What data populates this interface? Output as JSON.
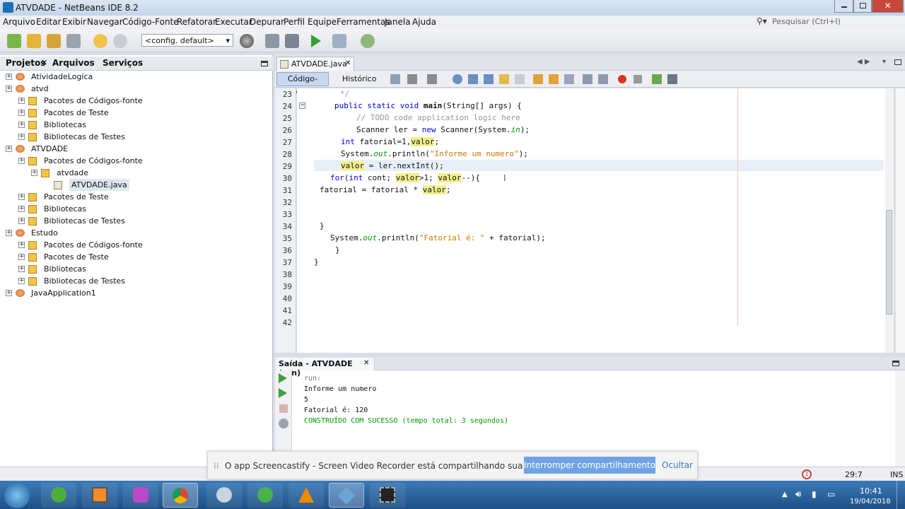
{
  "window": {
    "title": "ATVDADE - NetBeans IDE 8.2"
  },
  "menu": [
    "Arquivo",
    "Editar",
    "Exibir",
    "Navegar",
    "Código-Fonte",
    "Refatorar",
    "Executar",
    "Depurar",
    "Perfil",
    "Equipe",
    "Ferramentas",
    "Janela",
    "Ajuda"
  ],
  "search": {
    "placeholder": "Pesquisar (Ctrl+I)"
  },
  "toolbar": {
    "config": "<config. default>"
  },
  "left_tabs": [
    "Projetos",
    "Arquivos",
    "Serviços"
  ],
  "tree": [
    {
      "label": "AtividadeLogica",
      "level": 0,
      "icon": "project"
    },
    {
      "label": "atvd",
      "level": 0,
      "icon": "project"
    },
    {
      "label": "Pacotes de Códigos-fonte",
      "level": 1,
      "icon": "package"
    },
    {
      "label": "Pacotes de Teste",
      "level": 1,
      "icon": "package"
    },
    {
      "label": "Bibliotecas",
      "level": 1,
      "icon": "library"
    },
    {
      "label": "Bibliotecas de Testes",
      "level": 1,
      "icon": "library"
    },
    {
      "label": "ATVDADE",
      "level": 0,
      "icon": "project"
    },
    {
      "label": "Pacotes de Códigos-fonte",
      "level": 1,
      "icon": "package"
    },
    {
      "label": "atvdade",
      "level": 2,
      "icon": "package"
    },
    {
      "label": "ATVDADE.java",
      "level": 3,
      "icon": "java-file"
    },
    {
      "label": "Pacotes de Teste",
      "level": 1,
      "icon": "package"
    },
    {
      "label": "Bibliotecas",
      "level": 1,
      "icon": "library"
    },
    {
      "label": "Bibliotecas de Testes",
      "level": 1,
      "icon": "library"
    },
    {
      "label": "Estudo",
      "level": 0,
      "icon": "project"
    },
    {
      "label": "Pacotes de Códigos-fonte",
      "level": 1,
      "icon": "package"
    },
    {
      "label": "Pacotes de Teste",
      "level": 1,
      "icon": "package"
    },
    {
      "label": "Bibliotecas",
      "level": 1,
      "icon": "library"
    },
    {
      "label": "Bibliotecas de Testes",
      "level": 1,
      "icon": "library"
    },
    {
      "label": "JavaApplication1",
      "level": 0,
      "icon": "project"
    }
  ],
  "editor": {
    "tab": "ATVDADE.java",
    "subtabs": [
      "Código-Fonte",
      "Histórico"
    ],
    "line_numbers": [
      "23",
      "24",
      "25",
      "26",
      "27",
      "28",
      "29",
      "30",
      "31",
      "32",
      "33",
      "34",
      "35",
      "36",
      "37",
      "38",
      "39",
      "40",
      "41",
      "42"
    ],
    "code": {
      "l23": "*/",
      "l24a": "public static void ",
      "l24b": "main",
      "l24c": "(String[] args) {",
      "l25": "// TODO code application logic here",
      "l26a": "Scanner ler = ",
      "l26b": "new",
      "l26c": " Scanner(System.",
      "l26d": "in",
      "l26e": ");",
      "l27a": "int",
      "l27b": " fatorial=1,",
      "l27c": "valor",
      "l27d": ";",
      "l28a": "System.",
      "l28b": "out",
      "l28c": ".println(",
      "l28d": "\"Informe um numero\"",
      "l28e": ");",
      "l29a": "valor",
      "l29b": " = ler.nextInt();",
      "l30a": "for",
      "l30b": "(",
      "l30c": "int",
      "l30d": " cont; ",
      "l30e": "valor",
      "l30f": ">1; ",
      "l30g": "valor",
      "l30h": "--){",
      "l31a": "fatorial = fatorial * ",
      "l31b": "valor",
      "l31c": ";",
      "l34": "}",
      "l35a": "System.",
      "l35b": "out",
      "l35c": ".println(",
      "l35d": "\"Fatorial é: \"",
      "l35e": " + fatorial);",
      "l36": "}",
      "l37": "}"
    }
  },
  "output": {
    "tab": "Saída - ATVDADE (run)",
    "lines": [
      "run:",
      "Informe um numero",
      "5",
      "Fatorial é: 120",
      "CONSTRUÍDO COM SUCESSO (tempo total: 3 segundos)"
    ]
  },
  "status": {
    "position": "29:7",
    "mode": "INS",
    "notifications": "1"
  },
  "notification": {
    "text": "O app Screencastify - Screen Video Recorder está compartilhando sua tela e áudio.",
    "stop": "Interromper compartilhamento",
    "hide": "Ocultar"
  },
  "taskbar": {
    "time": "10:41",
    "date": "19/04/2018"
  },
  "colors": {
    "keyword": "#0000e6",
    "string": "#ce7b00",
    "comment": "#969696",
    "highlight": "#f3f08a",
    "field": "#009900",
    "success": "#009900"
  }
}
